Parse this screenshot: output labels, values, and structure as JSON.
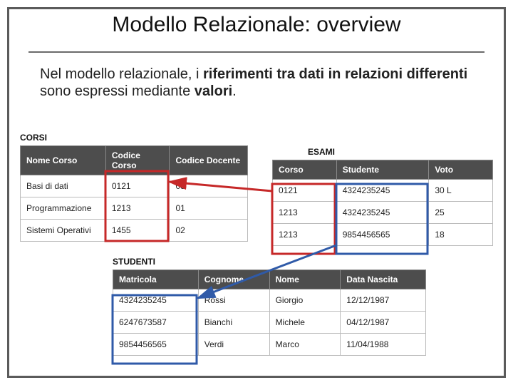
{
  "title": "Modello Relazionale: overview",
  "lead_html": "Nel modello relazionale, i <b>riferimenti tra dati in relazioni differenti</b> sono espressi mediante <b>valori</b>.",
  "lead_plain": "Nel modello relazionale, i riferimenti tra dati in relazioni differenti sono espressi mediante valori.",
  "labels": {
    "corsi": "CORSI",
    "esami": "ESAMI",
    "studenti": "STUDENTI"
  },
  "corsi": {
    "headers": [
      "Nome Corso",
      "Codice Corso",
      "Codice Docente"
    ],
    "rows": [
      [
        "Basi di dati",
        "0121",
        "03"
      ],
      [
        "Programmazione",
        "1213",
        "01"
      ],
      [
        "Sistemi Operativi",
        "1455",
        "02"
      ]
    ]
  },
  "esami": {
    "headers": [
      "Corso",
      "Studente",
      "Voto"
    ],
    "rows": [
      [
        "0121",
        "4324235245",
        "30 L"
      ],
      [
        "1213",
        "4324235245",
        "25"
      ],
      [
        "1213",
        "9854456565",
        "18"
      ]
    ]
  },
  "studenti": {
    "headers": [
      "Matricola",
      "Cognome",
      "Nome",
      "Data Nascita"
    ],
    "rows": [
      [
        "4324235245",
        "Rossi",
        "Giorgio",
        "12/12/1987"
      ],
      [
        "6247673587",
        "Bianchi",
        "Michele",
        "04/12/1987"
      ],
      [
        "9854456565",
        "Verdi",
        "Marco",
        "11/04/1988"
      ]
    ]
  },
  "colors": {
    "highlight": "#c62828",
    "arrow_1": "#c62828",
    "arrow_2": "#2f5aa8",
    "table_header_bg": "#4d4d4d",
    "frame": "#5b5b5b"
  }
}
